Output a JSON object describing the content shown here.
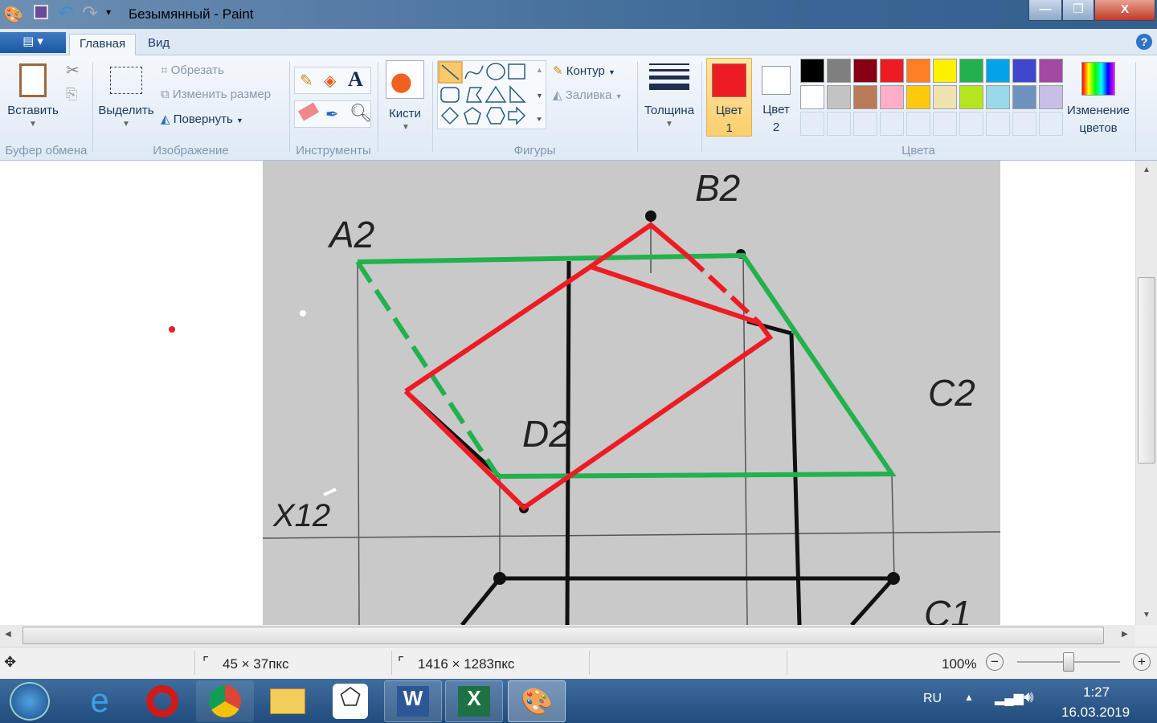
{
  "window": {
    "title": "Безымянный - Paint",
    "minimize": "—",
    "restore": "❐",
    "close": "X"
  },
  "tabs": [
    {
      "label": "Главная",
      "active": true
    },
    {
      "label": "Вид",
      "active": false
    }
  ],
  "clipboard": {
    "paste": "Вставить",
    "group": "Буфер обмена"
  },
  "image": {
    "select": "Выделить",
    "crop": "Обрезать",
    "resize": "Изменить размер",
    "rotate": "Повернуть",
    "group": "Изображение"
  },
  "tools": {
    "group": "Инструменты",
    "text_glyph": "A"
  },
  "brushes": {
    "label": "Кисти"
  },
  "shapes": {
    "group": "Фигуры",
    "outline": "Контур",
    "fill": "Заливка"
  },
  "size": {
    "label": "Толщина"
  },
  "colors": {
    "color1": "Цвет",
    "color1_num": "1",
    "color2": "Цвет",
    "color2_num": "2",
    "edit": "Изменение",
    "edit2": "цветов",
    "group": "Цвета",
    "color1_value": "#ed1c24",
    "color2_value": "#ffffff",
    "palette": [
      "#000000",
      "#7f7f7f",
      "#880015",
      "#ed1c24",
      "#ff7f27",
      "#fff200",
      "#22b14c",
      "#00a2e8",
      "#3f48cc",
      "#a349a4",
      "#ffffff",
      "#c3c3c3",
      "#b97a57",
      "#ffaec9",
      "#ffc90e",
      "#efe4b0",
      "#b5e61d",
      "#99d9ea",
      "#7092be",
      "#c8bfe7"
    ]
  },
  "drawing": {
    "labels": {
      "a2": "A2",
      "b2": "B2",
      "c2": "C2",
      "d2": "D2",
      "x12": "X12",
      "c1": "C1"
    }
  },
  "status": {
    "selection": "45 × 37пкс",
    "image_size": "1416 × 1283пкс",
    "zoom": "100%"
  },
  "taskbar": {
    "lang": "RU",
    "time": "1:27",
    "date": "16.03.2019"
  }
}
